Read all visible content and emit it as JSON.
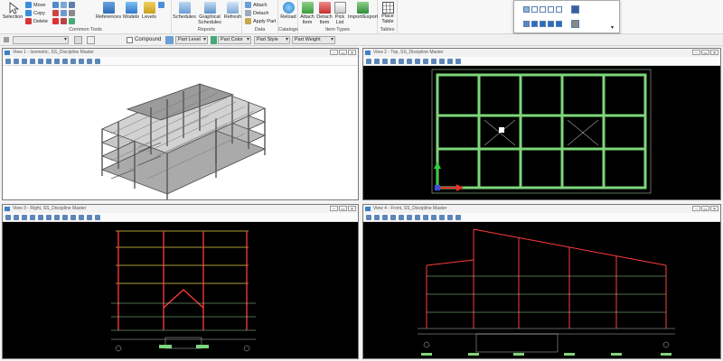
{
  "ribbon": {
    "groups": [
      {
        "label": "Common Tools"
      },
      {
        "label": "Reports"
      },
      {
        "label": "Data"
      },
      {
        "label": "Catalogs"
      },
      {
        "label": "Item Types"
      },
      {
        "label": "Tables"
      }
    ],
    "selection": "Selection",
    "move": "Move",
    "copy": "Copy",
    "delete": "Delete",
    "references": "References",
    "models": "Models",
    "levels": "Levels",
    "schedules": "Schedules",
    "graphical_schedules": "Graphical Schedules",
    "refresh": "Refresh",
    "attach": "Attach",
    "detach": "Detach",
    "apply_part": "Apply Part",
    "reload": "Reload",
    "attach_item": "Attach Item",
    "detach_item": "Detach Item",
    "pick_list": "Pick List",
    "import_export": "Import/Export",
    "place_table": "Place Table"
  },
  "attrbar": {
    "compound": "Compound",
    "part_level": "Part Level",
    "part_color": "Part Color",
    "part_style": "Part Style",
    "part_weight": "Part Weight"
  },
  "views": [
    {
      "title": "View 1 - Isometric, SS_Discipline Master"
    },
    {
      "title": "View 2 - Top, SS_Discipline Master"
    },
    {
      "title": "View 3 - Right, SS_Discipline Master"
    },
    {
      "title": "View 4 - Front, SS_Discipline Master"
    }
  ],
  "window_controls": {
    "minimize": "–",
    "restore": "▭",
    "close": "✕"
  },
  "colors": {
    "accent": "#3f7fc9",
    "view_background_dark": "#000000",
    "grid_green": "#7ed67a",
    "member_red": "#ff3b3b",
    "member_yellow": "#e6d24a"
  }
}
